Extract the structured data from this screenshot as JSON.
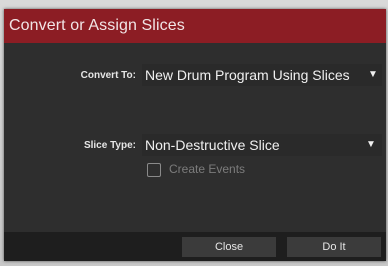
{
  "dialog": {
    "title": "Convert or Assign Slices"
  },
  "convert_to": {
    "label": "Convert To:",
    "value": "New Drum Program Using Slices"
  },
  "slice_type": {
    "label": "Slice Type:",
    "value": "Non-Destructive Slice"
  },
  "create_events": {
    "label": "Create Events",
    "checked": false
  },
  "footer": {
    "close_label": "Close",
    "do_it_label": "Do It"
  },
  "colors": {
    "title_bar": "#8c1d24",
    "dialog_bg": "#2e2e2e",
    "footer_bg": "#1e1e1e",
    "button_bg": "#3b3b3b"
  },
  "icons": {
    "dropdown": "caret-down-icon"
  }
}
